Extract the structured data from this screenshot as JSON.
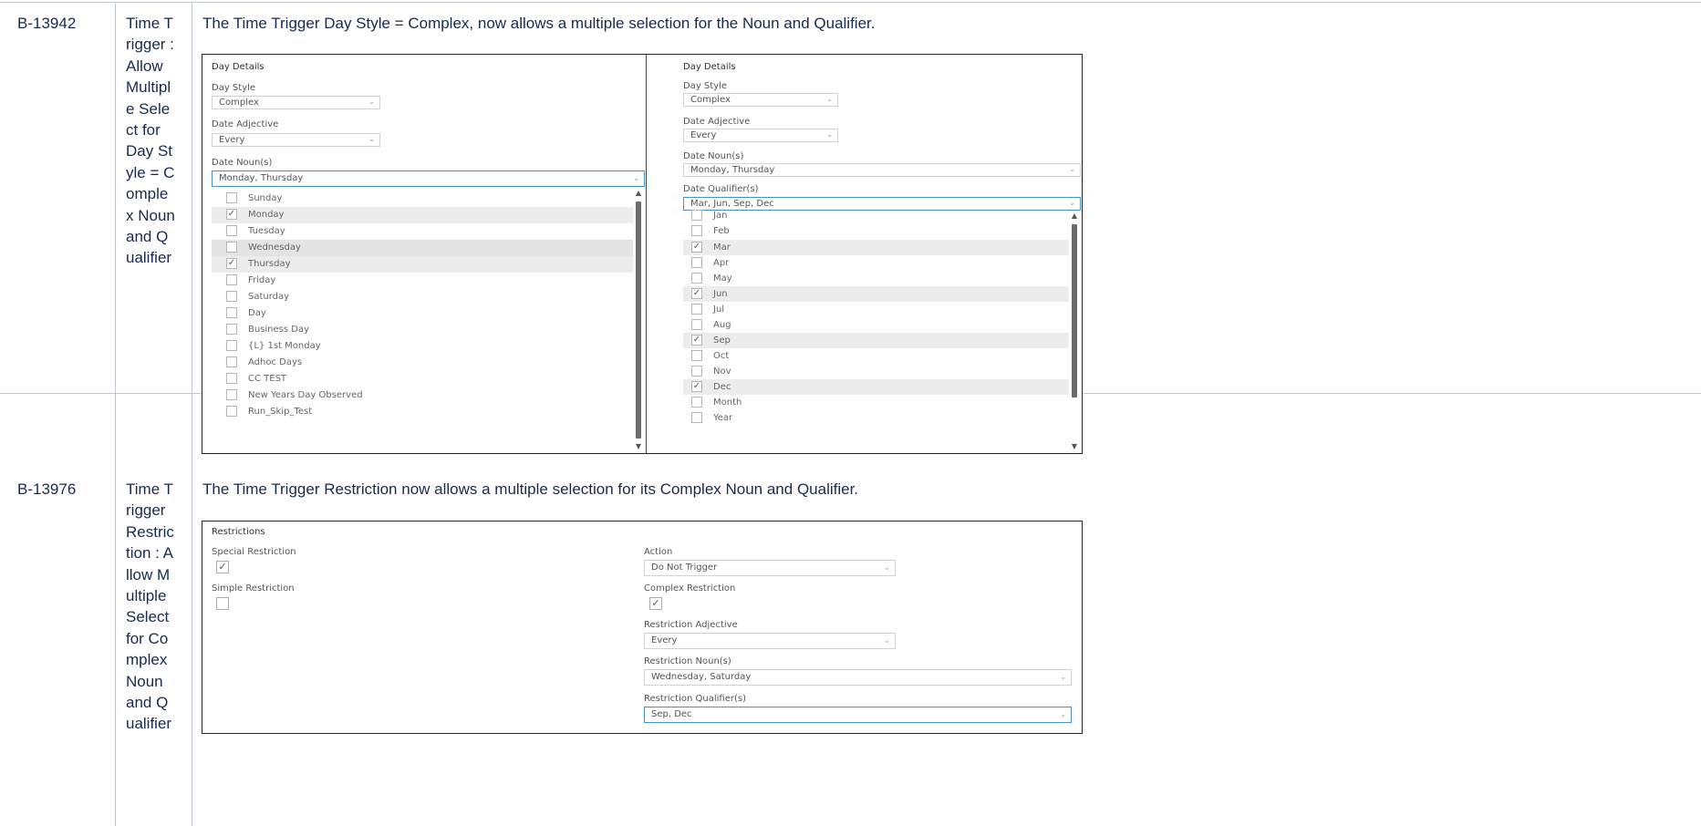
{
  "rows": [
    {
      "id": "B-13942",
      "name": "Time Trigger : Allow Multiple Select for Day Style = Complex Noun and Qualifier",
      "description": "The Time Trigger Day Style = Complex, now allows a multiple selection for the Noun and Qualifier.",
      "left_pane": {
        "section_title": "Day Details",
        "day_style_label": "Day Style",
        "day_style_value": "Complex",
        "date_adjective_label": "Date Adjective",
        "date_adjective_value": "Every",
        "date_nouns_label": "Date Noun(s)",
        "date_nouns_value": "Monday, Thursday",
        "options": [
          {
            "label": "Sunday",
            "checked": false
          },
          {
            "label": "Monday",
            "checked": true
          },
          {
            "label": "Tuesday",
            "checked": false
          },
          {
            "label": "Wednesday",
            "checked": false
          },
          {
            "label": "Thursday",
            "checked": true
          },
          {
            "label": "Friday",
            "checked": false
          },
          {
            "label": "Saturday",
            "checked": false
          },
          {
            "label": "Day",
            "checked": false
          },
          {
            "label": "Business Day",
            "checked": false
          },
          {
            "label": "{L} 1st Monday",
            "checked": false
          },
          {
            "label": "Adhoc Days",
            "checked": false
          },
          {
            "label": "CC TEST",
            "checked": false
          },
          {
            "label": "New Years Day Observed",
            "checked": false
          },
          {
            "label": "Run_Skip_Test",
            "checked": false
          }
        ]
      },
      "right_pane": {
        "section_title": "Day Details",
        "day_style_label": "Day Style",
        "day_style_value": "Complex",
        "date_adjective_label": "Date Adjective",
        "date_adjective_value": "Every",
        "date_nouns_label": "Date Noun(s)",
        "date_nouns_value": "Monday, Thursday",
        "date_qualifiers_label": "Date Qualifier(s)",
        "date_qualifiers_value": "Mar, Jun, Sep, Dec",
        "options": [
          {
            "label": "Jan",
            "checked": false
          },
          {
            "label": "Feb",
            "checked": false
          },
          {
            "label": "Mar",
            "checked": true
          },
          {
            "label": "Apr",
            "checked": false
          },
          {
            "label": "May",
            "checked": false
          },
          {
            "label": "Jun",
            "checked": true
          },
          {
            "label": "Jul",
            "checked": false
          },
          {
            "label": "Aug",
            "checked": false
          },
          {
            "label": "Sep",
            "checked": true
          },
          {
            "label": "Oct",
            "checked": false
          },
          {
            "label": "Nov",
            "checked": false
          },
          {
            "label": "Dec",
            "checked": true
          },
          {
            "label": "Month",
            "checked": false
          },
          {
            "label": "Year",
            "checked": false
          }
        ]
      }
    },
    {
      "id": "B-13976",
      "name": "Time Trigger Restriction : Allow Multiple Select for Complex Noun and Qualifier",
      "description": "The Time Trigger Restriction now allows a multiple selection for its Complex Noun and Qualifier.",
      "restrictions": {
        "section_title": "Restrictions",
        "special_label": "Special Restriction",
        "special_checked": true,
        "simple_label": "Simple Restriction",
        "simple_checked": false,
        "action_label": "Action",
        "action_value": "Do Not Trigger",
        "complex_label": "Complex Restriction",
        "complex_checked": true,
        "adjective_label": "Restriction Adjective",
        "adjective_value": "Every",
        "nouns_label": "Restriction Noun(s)",
        "nouns_value": "Wednesday, Saturday",
        "qualifiers_label": "Restriction Qualifier(s)",
        "qualifiers_value": "Sep, Dec"
      }
    }
  ],
  "glyphs": {
    "check": "✓",
    "caret_down": "⌄",
    "arrow_up": "▲",
    "arrow_down": "▼"
  }
}
